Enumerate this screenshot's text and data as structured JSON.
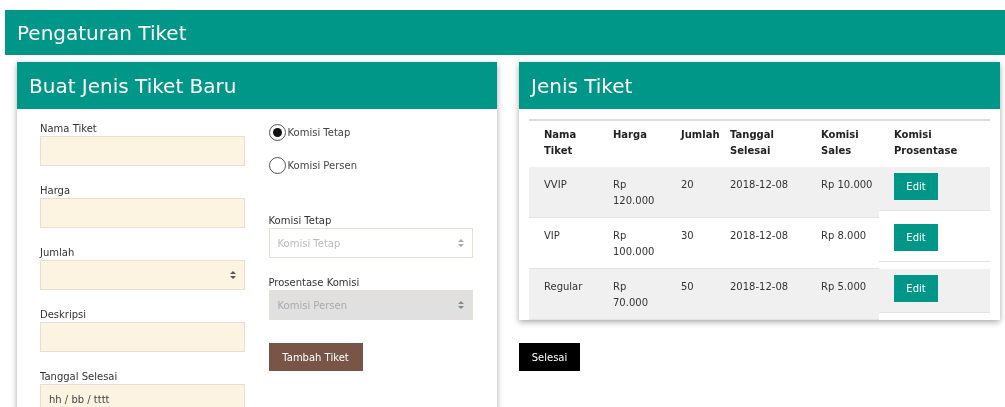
{
  "header": {
    "title": "Pengaturan Tiket"
  },
  "form_card": {
    "title": "Buat Jenis Tiket Baru",
    "fields": [
      {
        "label": "Nama Tiket",
        "kind": "text"
      },
      {
        "label": "Harga",
        "kind": "text"
      },
      {
        "label": "Jumlah",
        "kind": "number"
      },
      {
        "label": "Deskripsi",
        "kind": "text"
      },
      {
        "label": "Tanggal Selesai",
        "kind": "date",
        "placeholder": "hh / bb / tttt"
      }
    ],
    "radios": [
      {
        "label": "Komisi Tetap",
        "selected": true
      },
      {
        "label": "Komisi Persen",
        "selected": false
      }
    ],
    "commission_fields": [
      {
        "label": "Komisi Tetap",
        "placeholder": "Komisi Tetap",
        "disabled": false
      },
      {
        "label": "Prosentase Komisi",
        "placeholder": "Komisi Persen",
        "disabled": true
      }
    ],
    "submit_button": "Tambah Tiket"
  },
  "table_card": {
    "title": "Jenis Tiket",
    "columns": [
      "Nama Tiket",
      "Harga",
      "Jumlah",
      "Tanggal Selesai",
      "Komisi Sales",
      "Komisi Prosentase"
    ],
    "rows": [
      {
        "cells": [
          "VVIP",
          "Rp 120.000",
          "20",
          "2018-12-08",
          "Rp 10.000"
        ],
        "action": "Edit"
      },
      {
        "cells": [
          "VIP",
          "Rp 100.000",
          "30",
          "2018-12-08",
          "Rp 8.000"
        ],
        "action": "Edit"
      },
      {
        "cells": [
          "Regular",
          "Rp 70.000",
          "50",
          "2018-12-08",
          "Rp 5.000"
        ],
        "action": "Edit"
      }
    ]
  },
  "done_button": "Selesai"
}
